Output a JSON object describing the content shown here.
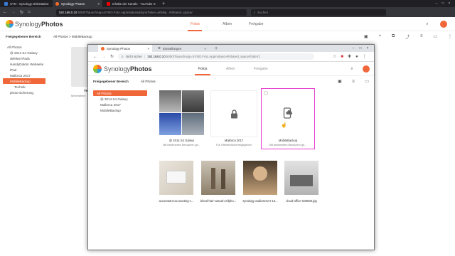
{
  "outer_tabs": [
    {
      "label": "SYN - Synology DiskStation",
      "color": "#3a7bd5"
    },
    {
      "label": "Synology Photos",
      "color": "#f56b2a"
    },
    {
      "label": "Inhalte der Kanals - YouTube S",
      "color": "#e00"
    }
  ],
  "outer_url": {
    "host": "192.168.0.10",
    "rest": ":5000/?launchApp=SYNO.Foto.AppInstance&SynoToken=a0Nhp...#/shared_space/"
  },
  "outer_search_placeholder": "Suchen",
  "app": {
    "logo_synology": "Synology",
    "logo_photos": "Photos",
    "tabs": [
      "Fotos",
      "Alben",
      "Freigabe"
    ],
    "active_tab": "Fotos"
  },
  "outer_crumbs": {
    "left": "Freigegebener Bereich",
    "path": "All Photos > MobileBackup"
  },
  "outer_tree": [
    "All Photos",
    "@ 2014 S4 Galaxy",
    "defekte iPads",
    "HandyDoktor Webseite",
    "iPad",
    "Mallorca 2017",
    "MobileBackup",
    "Technik",
    "photo-sicherung"
  ],
  "outer_bg": {
    "card_title": "Te",
    "card_sub": "Mit bestimm"
  },
  "inner_tabs": [
    {
      "label": "Synology Photos"
    },
    {
      "label": "Einstellungen"
    }
  ],
  "inner_url": {
    "insecure": "Nicht sicher",
    "host": "192.168.0.10",
    "rest": ":5000/?launchApp=SYNO.Foto.AppInstance#/shared_space/folder/1"
  },
  "inner_crumbs": {
    "left": "Freigegebener Bereich",
    "right": "All Photos"
  },
  "inner_tree": [
    "All Photos",
    "@ 2014 S4 Galaxy",
    "Mallorca 2017",
    "MobileBackup"
  ],
  "folders": [
    {
      "title": "@ 2014 S4 Galaxy",
      "sub": "Mit bestimmten Benutzern ge..."
    },
    {
      "title": "Mallorca 2017",
      "sub": "Für Öffentlichkeit freigegeben"
    },
    {
      "title": "MobileBackup",
      "sub": "Mit bestimmten Benutzern ge..."
    }
  ],
  "photos": [
    {
      "name": "accountant-accounting-c..."
    },
    {
      "name": "blond-hair-casual-cellpho..."
    },
    {
      "name": "synology-audioserver-10..."
    },
    {
      "name": "cloud-office-639839.jpg"
    }
  ],
  "colors": {
    "accent": "#f0673a",
    "highlight": "#e63ecf"
  }
}
